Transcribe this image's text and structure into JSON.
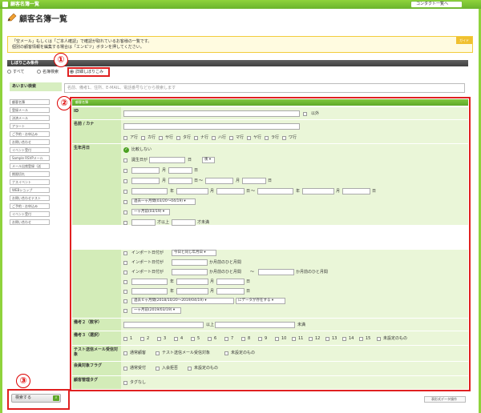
{
  "app": {
    "title": "顧客名簿一覧",
    "contact_label": "コンタクト一覧へ"
  },
  "page": {
    "title": "顧客名簿一覧"
  },
  "notice": {
    "line1": "「空メール」もしくは「ご本人確認」で確認が取れているお客様の一覧です。",
    "line2": "個別の顧客情報を編集する場合は「エンピツ」ボタンを押してください。",
    "tag": "ガイド"
  },
  "filter": {
    "title": "しぼりこみ条件",
    "opt_all": "すべて",
    "opt_group": "名簿検索",
    "opt_detail": "詳細しぼりこみ"
  },
  "sidebar": {
    "head": "あいまい検索",
    "items": [
      "顧客名簿",
      "登録メール",
      "決済メール",
      "アラート",
      "ご予約・お申込み",
      "お問い合わせ",
      "イベント受付",
      "Sample RSVPメール",
      "メール出席登録（送",
      "期限切れ",
      "ナスイベント",
      "WEBショップ",
      "お問い合わせテスト",
      "ご予約・お申込み",
      "イベント受付",
      "お問い合わせ"
    ]
  },
  "search": {
    "placeholder": "名前、備考1、住所、E-MAIL、電話番号などから検索します"
  },
  "detail": {
    "head": "顧客名簿"
  },
  "fields": {
    "id": {
      "label": "ID",
      "exclude": "以外"
    },
    "name": {
      "label": "名前 / カナ",
      "kana": [
        "ア行",
        "カ行",
        "サ行",
        "タ行",
        "ナ行",
        "ハ行",
        "マ行",
        "ヤ行",
        "ラ行",
        "ワ行"
      ]
    },
    "birth": {
      "label": "生年月日",
      "nocompare": "比較しない",
      "bday": "誕生日が",
      "day": "日",
      "after": "後",
      "month": "月",
      "year": "年",
      "tilde": "〜",
      "period": "過去一ヶ月間(03/20〜04/19)",
      "onemonth": "一ヶ月前(03/19)",
      "above": "才以上",
      "below": "才未満"
    },
    "import": {
      "l1": "インポート日付が",
      "same": "今日と同じ年月日",
      "months_ago": "か月前のひと月間",
      "year": "年",
      "month": "月",
      "day": "日",
      "period": "過去６ヶ月間(2018/10/20〜2019/04/19)",
      "exists": "にデータが存在する",
      "onemonth": "一ヶ月前(2019/03/19)",
      "tilde": "〜"
    },
    "bikou2": {
      "label": "備考２（数字）",
      "above": "以上",
      "below": "未満"
    },
    "bikou3": {
      "label": "備考３（選択）",
      "opts": [
        "1",
        "2",
        "3",
        "4",
        "5",
        "6",
        "7",
        "8",
        "9",
        "10",
        "11",
        "12",
        "13",
        "14",
        "15"
      ],
      "unset": "未設定のもの"
    },
    "test": {
      "label": "テスト送信メール受信対象",
      "opt1": "通常顧客",
      "opt2": "テスト送信メール受信対象",
      "opt3": "未設定のもの"
    },
    "member": {
      "label": "会員対象フラグ",
      "opt1": "通常受付",
      "opt2": "入会拒否",
      "opt3": "未設定のもの"
    },
    "tag": {
      "label": "顧客管理タグ",
      "opt1": "タグなし"
    }
  },
  "buttons": {
    "search": "検索する",
    "grid": "表形式データ操作"
  },
  "markers": {
    "m1": "①",
    "m2": "②",
    "m3": "③"
  }
}
